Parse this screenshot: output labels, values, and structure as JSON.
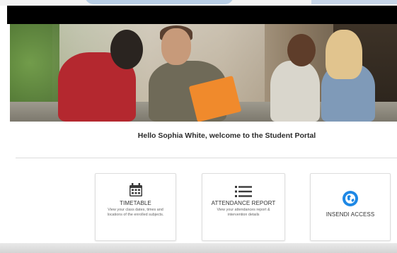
{
  "portal": {
    "welcome_message": "Hello Sophia White, welcome to the Student Portal"
  },
  "cards": [
    {
      "title": "TIMETABLE",
      "description": "View your class dates, times and locations of the enrolled subjects.",
      "icon": "calendar-icon"
    },
    {
      "title": "ATTENDANCE REPORT",
      "description": "View your attendances report & intervention details",
      "icon": "list-icon"
    },
    {
      "title": "INSENDI ACCESS",
      "description": "",
      "icon": "globe-icon"
    }
  ],
  "colors": {
    "header_bar": "#000000",
    "icon_dark": "#3a3a3a",
    "insendi_icon": "#1e88e5",
    "hero_book": "#f08a2c"
  }
}
